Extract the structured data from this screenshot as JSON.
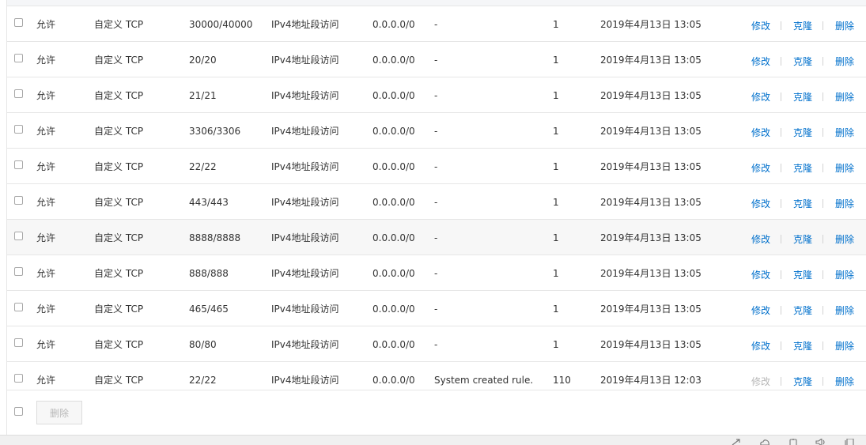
{
  "rules": [
    {
      "policy": "允许",
      "protocol": "自定义 TCP",
      "port_range": "30000/40000",
      "auth_type": "IPv4地址段访问",
      "auth_object": "0.0.0.0/0",
      "description": "-",
      "priority": "1",
      "created_at": "2019年4月13日 13:05",
      "edit_enabled": true
    },
    {
      "policy": "允许",
      "protocol": "自定义 TCP",
      "port_range": "20/20",
      "auth_type": "IPv4地址段访问",
      "auth_object": "0.0.0.0/0",
      "description": "-",
      "priority": "1",
      "created_at": "2019年4月13日 13:05",
      "edit_enabled": true
    },
    {
      "policy": "允许",
      "protocol": "自定义 TCP",
      "port_range": "21/21",
      "auth_type": "IPv4地址段访问",
      "auth_object": "0.0.0.0/0",
      "description": "-",
      "priority": "1",
      "created_at": "2019年4月13日 13:05",
      "edit_enabled": true
    },
    {
      "policy": "允许",
      "protocol": "自定义 TCP",
      "port_range": "3306/3306",
      "auth_type": "IPv4地址段访问",
      "auth_object": "0.0.0.0/0",
      "description": "-",
      "priority": "1",
      "created_at": "2019年4月13日 13:05",
      "edit_enabled": true
    },
    {
      "policy": "允许",
      "protocol": "自定义 TCP",
      "port_range": "22/22",
      "auth_type": "IPv4地址段访问",
      "auth_object": "0.0.0.0/0",
      "description": "-",
      "priority": "1",
      "created_at": "2019年4月13日 13:05",
      "edit_enabled": true
    },
    {
      "policy": "允许",
      "protocol": "自定义 TCP",
      "port_range": "443/443",
      "auth_type": "IPv4地址段访问",
      "auth_object": "0.0.0.0/0",
      "description": "-",
      "priority": "1",
      "created_at": "2019年4月13日 13:05",
      "edit_enabled": true
    },
    {
      "policy": "允许",
      "protocol": "自定义 TCP",
      "port_range": "8888/8888",
      "auth_type": "IPv4地址段访问",
      "auth_object": "0.0.0.0/0",
      "description": "-",
      "priority": "1",
      "created_at": "2019年4月13日 13:05",
      "edit_enabled": true,
      "highlighted": true
    },
    {
      "policy": "允许",
      "protocol": "自定义 TCP",
      "port_range": "888/888",
      "auth_type": "IPv4地址段访问",
      "auth_object": "0.0.0.0/0",
      "description": "-",
      "priority": "1",
      "created_at": "2019年4月13日 13:05",
      "edit_enabled": true
    },
    {
      "policy": "允许",
      "protocol": "自定义 TCP",
      "port_range": "465/465",
      "auth_type": "IPv4地址段访问",
      "auth_object": "0.0.0.0/0",
      "description": "-",
      "priority": "1",
      "created_at": "2019年4月13日 13:05",
      "edit_enabled": true
    },
    {
      "policy": "允许",
      "protocol": "自定义 TCP",
      "port_range": "80/80",
      "auth_type": "IPv4地址段访问",
      "auth_object": "0.0.0.0/0",
      "description": "-",
      "priority": "1",
      "created_at": "2019年4月13日 13:05",
      "edit_enabled": true
    },
    {
      "policy": "允许",
      "protocol": "自定义 TCP",
      "port_range": "22/22",
      "auth_type": "IPv4地址段访问",
      "auth_object": "0.0.0.0/0",
      "description": "System created rule.",
      "priority": "110",
      "created_at": "2019年4月13日 12:03",
      "edit_enabled": false
    }
  ],
  "actions": {
    "edit_label": "修改",
    "clone_label": "克隆",
    "delete_label": "删除"
  },
  "footer": {
    "batch_delete_label": "删除"
  },
  "colors": {
    "link": "#0070cc",
    "disabled_text": "#b8b8b8",
    "row_border": "#e6e6e6",
    "row_highlight": "#f7f7f7"
  },
  "taskbar_icons": [
    "arrow-icon",
    "cloud-icon",
    "gear-icon",
    "speaker-icon",
    "window-icon"
  ]
}
